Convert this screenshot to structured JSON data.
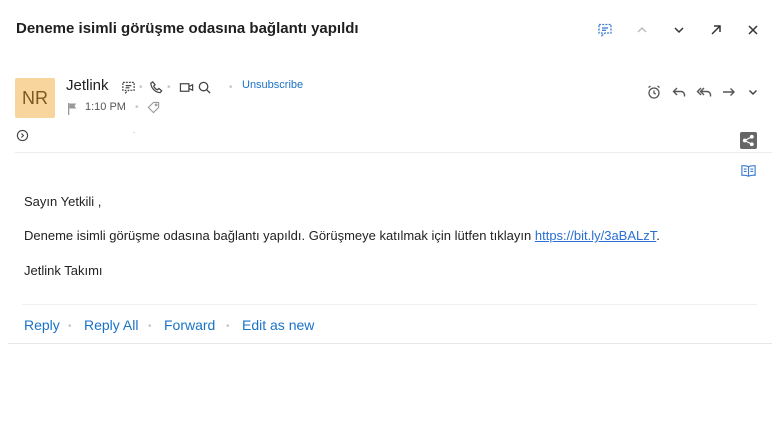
{
  "header": {
    "subject": "Deneme isimli görüşme odasına bağlantı yapıldı",
    "icons": [
      "comment-icon",
      "chevron-up-icon",
      "chevron-down-icon",
      "expand-icon",
      "close-icon"
    ]
  },
  "sender": {
    "initials": "NR",
    "avatar_color": "#f7d59c",
    "name": "Jetlink",
    "unsubscribe": "Unsubscribe",
    "time": "1:10 PM"
  },
  "body": {
    "greeting": "Sayın Yetkili ,",
    "message_prefix": "Deneme isimli görüşme odasına bağlantı yapıldı. Görüşmeye katılmak için lütfen tıklayın ",
    "link_text": "https://bit.ly/3aBALzT",
    "message_suffix": ".",
    "signature": "Jetlink Takımı"
  },
  "actions": {
    "reply": "Reply",
    "reply_all": "Reply All",
    "forward": "Forward",
    "edit_as_new": "Edit as new"
  },
  "colors": {
    "accent": "#1a73c7",
    "link": "#2a6fd6"
  }
}
